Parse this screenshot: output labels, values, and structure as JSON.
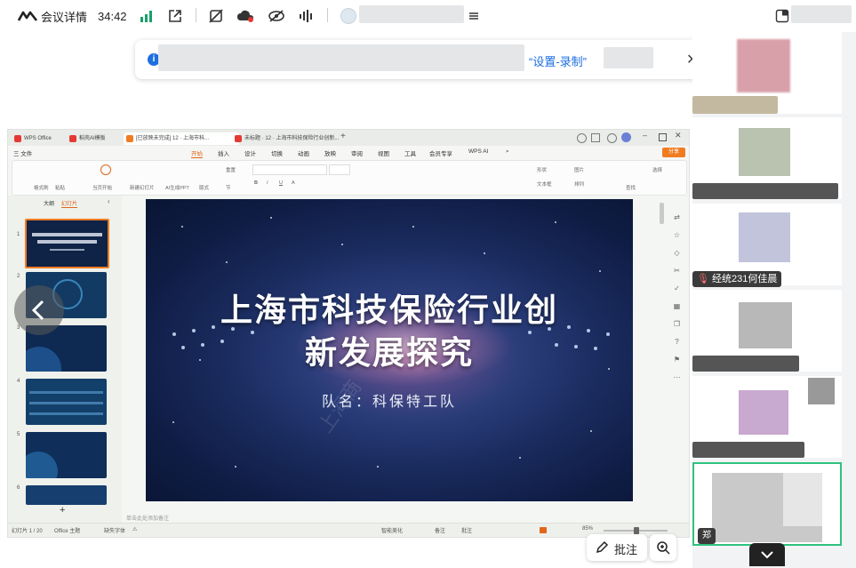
{
  "topbar": {
    "meeting_details_label": "会议详情",
    "timer": "34:42"
  },
  "banner": {
    "link_text": "“设置-录制”"
  },
  "wps": {
    "tabs": [
      {
        "label": "WPS Office"
      },
      {
        "label": "稻壳AI模板"
      },
      {
        "label": "[已放映未完成] 12 · 上海市科..."
      },
      {
        "label": "未标题 · 12 · 上海市科技保险行业创新..."
      }
    ],
    "menu": {
      "file": "三 文件",
      "items": [
        "开始",
        "插入",
        "设计",
        "切换",
        "动画",
        "放映",
        "审阅",
        "视图",
        "工具",
        "会员专享"
      ],
      "ai": "WPS AI",
      "share": "分享"
    },
    "ribbon": {
      "new_slide": "新建幻灯片",
      "ai_gen": "AI生成PPT",
      "layout": "版式",
      "reset": "重置",
      "section": "节",
      "from_start": "当页开始",
      "format_painter": "格式刷",
      "paste": "粘贴",
      "shape": "形状",
      "arrange": "排列",
      "find": "查找",
      "select": "选择",
      "textbox": "文本框",
      "image": "图片"
    },
    "panel_tabs": {
      "outline": "大纲",
      "slides": "幻灯片"
    },
    "slide_numbers": [
      "1",
      "2",
      "3",
      "4",
      "5",
      "6"
    ],
    "slide": {
      "title_line1": "上海市科技保险行业创",
      "title_line2": "新发展探究",
      "subtitle": "队名：科保特工队",
      "watermark": "上海商"
    },
    "notes_placeholder": "单击此处添加备注",
    "statusbar": {
      "slide_count": "幻灯片 1 / 20",
      "theme": "Office 主题",
      "missing": "缺失字体",
      "smart": "智能美化",
      "notes": "备注",
      "comments": "批注",
      "zoom": "85%"
    }
  },
  "controls": {
    "annotate_label": "批注"
  },
  "participants": [
    {
      "name": ""
    },
    {
      "name": ""
    },
    {
      "name": "经统231何佳晨"
    },
    {
      "name": ""
    },
    {
      "name": ""
    },
    {
      "name": "郑"
    }
  ]
}
